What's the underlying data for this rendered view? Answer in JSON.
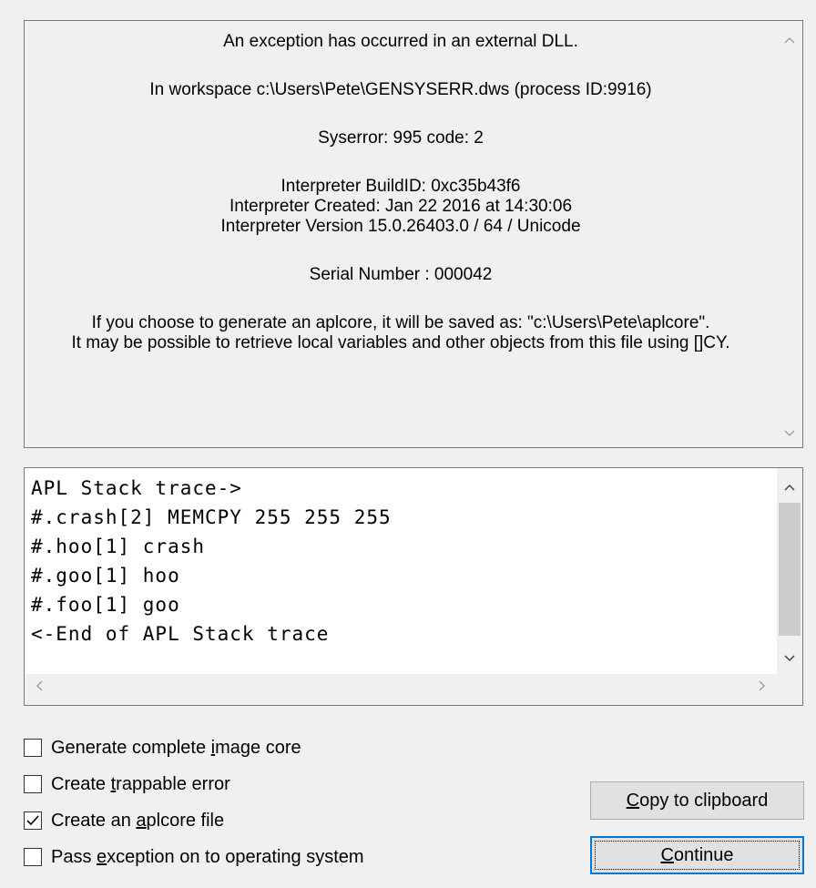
{
  "info": {
    "line1": "An exception has occurred in an external DLL.",
    "line2": "In workspace c:\\Users\\Pete\\GENSYSERR.dws (process ID:9916)",
    "line3": "Syserror: 995 code: 2",
    "build_id": "Interpreter BuildID: 0xc35b43f6",
    "created": "Interpreter Created: Jan 22 2016 at 14:30:06",
    "version": "Interpreter Version 15.0.26403.0 / 64 / Unicode",
    "serial": "Serial Number : 000042",
    "aplcore1": "If you choose to generate an aplcore, it will be saved as: \"c:\\Users\\Pete\\aplcore\".",
    "aplcore2": "It may be possible to retrieve local variables and other objects from this file using []CY."
  },
  "trace": {
    "lines": [
      "APL Stack trace->",
      "#.crash[2] MEMCPY 255 255 255",
      "#.hoo[1] crash",
      "#.goo[1] hoo",
      "#.foo[1] goo",
      "<-End of APL Stack trace"
    ]
  },
  "options": [
    {
      "pre": "Generate complete ",
      "key": "i",
      "post": "mage core",
      "checked": false
    },
    {
      "pre": "Create ",
      "key": "t",
      "post": "rappable error",
      "checked": false
    },
    {
      "pre": "Create an ",
      "key": "a",
      "post": "plcore file",
      "checked": true
    },
    {
      "pre": "Pass ",
      "key": "e",
      "post": "xception on to operating system",
      "checked": false
    }
  ],
  "buttons": {
    "copy": {
      "key": "C",
      "rest": "opy to clipboard"
    },
    "continue": {
      "key": "C",
      "rest": "ontinue"
    }
  },
  "icons": {
    "up": "chevron-up-icon",
    "down": "chevron-down-icon",
    "left": "chevron-left-icon",
    "right": "chevron-right-icon",
    "check": "checkmark-icon"
  }
}
